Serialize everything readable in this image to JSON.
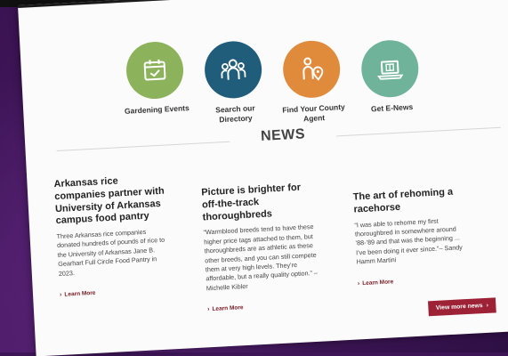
{
  "quick_links": [
    {
      "label": "Gardening Events",
      "icon": "calendar-check-icon",
      "color": "#8cb35c"
    },
    {
      "label": "Search our Directory",
      "icon": "people-group-icon",
      "color": "#1f5d7a"
    },
    {
      "label": "Find Your County Agent",
      "icon": "person-location-icon",
      "color": "#e08a3c"
    },
    {
      "label": "Get E-News",
      "icon": "laptop-newsletter-icon",
      "color": "#6fb39b"
    }
  ],
  "news": {
    "heading": "NEWS",
    "articles": [
      {
        "title": "Arkansas rice companies partner with University of Arkansas campus food pantry",
        "body": "Three Arkansas rice companies donated hundreds of pounds of rice to the University of Arkansas Jane B. Gearhart Full Circle Food Pantry in 2023.",
        "link": "Learn More"
      },
      {
        "title": "Picture is brighter for off-the-track thoroughbreds",
        "body": "“Warmblood breeds tend to have these higher price tags attached to them, but thoroughbreds are as athletic as these other breeds, and you can still compete them at very high levels. They’re affordable, but a really quality option.” – Michelle Kibler",
        "link": "Learn More"
      },
      {
        "title": "The art of rehoming a racehorse",
        "body": "“I was able to rehome my first thoroughbred in somewhere around ’88-’89 and that was the beginning ... I’ve been doing it ever since.”– Sandy Hamm Martini",
        "link": "Learn More"
      }
    ],
    "view_more": "View more news"
  },
  "colors": {
    "accent_red": "#9d2235",
    "link_red": "#7a1a22",
    "backdrop_purple": "#3e1657"
  }
}
